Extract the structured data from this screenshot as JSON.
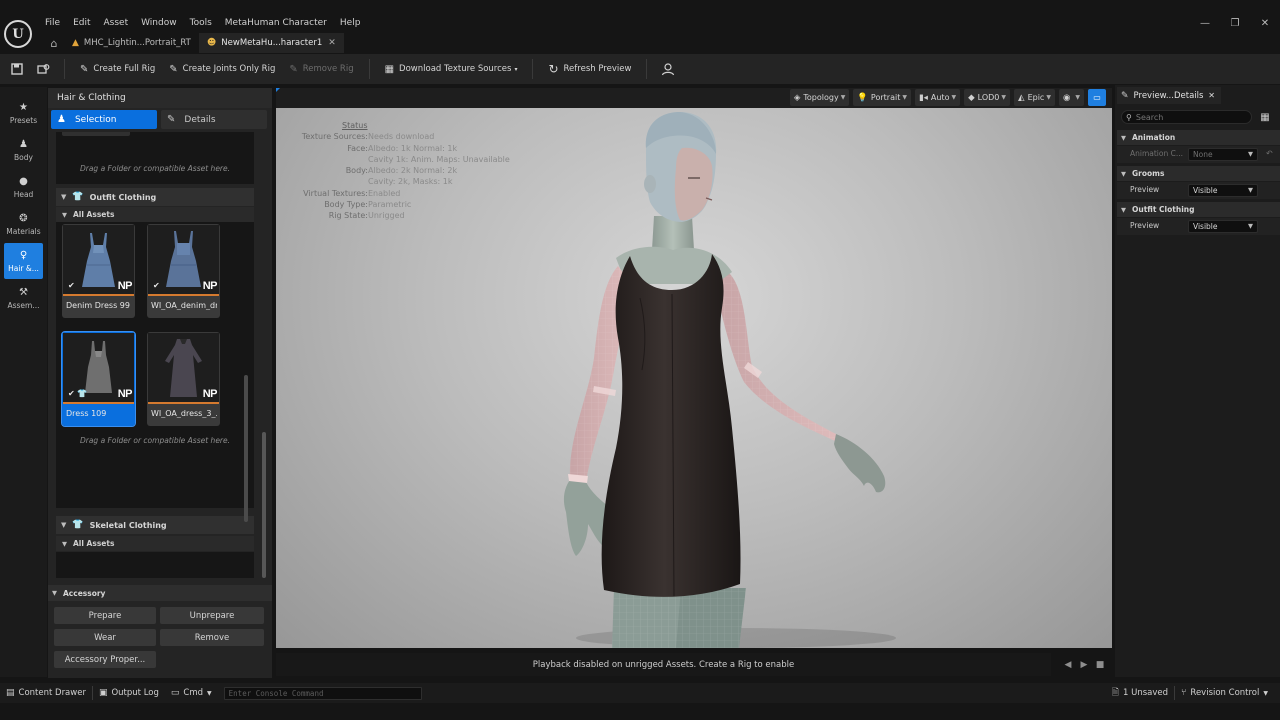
{
  "app": {
    "logo": "U"
  },
  "menu": [
    "File",
    "Edit",
    "Asset",
    "Window",
    "Tools",
    "MetaHuman Character",
    "Help"
  ],
  "window_controls": {
    "minimize": "—",
    "restore": "❐",
    "close": "✕"
  },
  "tabs": [
    {
      "label": "MHC_Lightin...Portrait_RT",
      "active": false
    },
    {
      "label": "NewMetaHu...haracter1",
      "active": true,
      "close": "✕"
    }
  ],
  "toolbar": {
    "create_full_rig": "Create Full Rig",
    "create_joints_only_rig": "Create Joints Only Rig",
    "remove_rig": "Remove Rig",
    "download_texture_sources": "Download Texture Sources",
    "refresh_preview": "Refresh Preview"
  },
  "modes": [
    {
      "label": "Presets",
      "icon": "star-icon"
    },
    {
      "label": "Body",
      "icon": "body-icon"
    },
    {
      "label": "Head",
      "icon": "head-icon"
    },
    {
      "label": "Materials",
      "icon": "materials-icon"
    },
    {
      "label": "Hair &...",
      "icon": "hair-icon",
      "active": true
    },
    {
      "label": "Assem...",
      "icon": "hammer-icon"
    }
  ],
  "left_panel": {
    "title": "Hair & Clothing",
    "segments": {
      "selection": "Selection",
      "details": "Details"
    },
    "drop_hint": "Drag a Folder or compatible Asset here.",
    "outfit_clothing": {
      "title": "Outfit Clothing",
      "subsection": "All Assets",
      "assets": [
        {
          "name": "Denim Dress 99",
          "badge": "NP",
          "checked": true,
          "selected": false
        },
        {
          "name": "WI_OA_denim_dr...",
          "badge": "NP",
          "checked": true,
          "selected": false
        },
        {
          "name": "Dress 109",
          "badge": "NP",
          "checked": true,
          "selected": true
        },
        {
          "name": "WI_OA_dress_3_...",
          "badge": "NP",
          "checked": false,
          "selected": false
        }
      ]
    },
    "skeletal_clothing": {
      "title": "Skeletal Clothing",
      "subsection": "All Assets"
    },
    "accessory": {
      "title": "Accessory",
      "buttons": {
        "prepare": "Prepare",
        "unprepare": "Unprepare",
        "wear": "Wear",
        "remove": "Remove",
        "properties": "Accessory Proper..."
      }
    }
  },
  "viewport": {
    "tools": {
      "topology": "Topology",
      "portrait": "Portrait",
      "auto": "Auto",
      "lod": "LOD0",
      "quality": "Epic"
    },
    "status": {
      "title": "Status",
      "rows": [
        {
          "key": "Texture Sources:",
          "value": "Needs download"
        },
        {
          "key": "Face:",
          "value": "Albedo: 1k Normal: 1k"
        },
        {
          "key": "",
          "value": "Cavity 1k: Anim. Maps: Unavailable"
        },
        {
          "key": "Body:",
          "value": "Albedo: 2k Normal: 2k"
        },
        {
          "key": "",
          "value": "Cavity: 2k, Masks: 1k"
        },
        {
          "key": "Virtual Textures:",
          "value": "Enabled"
        },
        {
          "key": "Body Type:",
          "value": "Parametric"
        },
        {
          "key": "Rig State:",
          "value": "Unrigged"
        }
      ]
    },
    "playback_message": "Playback disabled on unrigged Assets. Create a Rig to enable"
  },
  "details_panel": {
    "tab_title": "Preview...Details",
    "search_placeholder": "Search",
    "categories": [
      {
        "title": "Animation",
        "props": [
          {
            "label": "Animation C...",
            "value": "None",
            "disabled": true
          }
        ]
      },
      {
        "title": "Grooms",
        "props": [
          {
            "label": "Preview",
            "value": "Visible",
            "disabled": false
          }
        ]
      },
      {
        "title": "Outfit Clothing",
        "props": [
          {
            "label": "Preview",
            "value": "Visible",
            "disabled": false
          }
        ]
      }
    ]
  },
  "statusbar": {
    "content_drawer": "Content Drawer",
    "output_log": "Output Log",
    "cmd": "Cmd",
    "console_placeholder": "Enter Console Command",
    "unsaved": "1 Unsaved",
    "revision_control": "Revision Control"
  },
  "colors": {
    "accent": "#0a6fde",
    "thumb_bar": "#d57a2f",
    "dress": "#2a2423",
    "skin": "#a9b5ad"
  }
}
